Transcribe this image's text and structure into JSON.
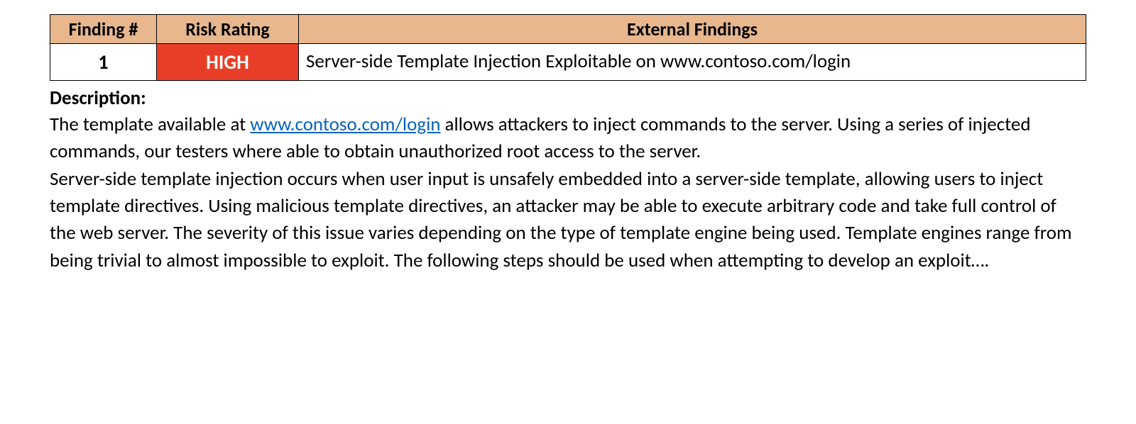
{
  "table": {
    "headers": {
      "finding": "Finding #",
      "risk": "Risk Rating",
      "external": "External Findings"
    },
    "row": {
      "finding_num": "1",
      "risk_rating": "HIGH",
      "summary": "Server-side Template Injection Exploitable on www.contoso.com/login"
    }
  },
  "description": {
    "label": "Description:",
    "para1_pre": "The template available at ",
    "para1_link_text": "www.contoso.com/login",
    "para1_link_href": "http://www.contoso.com/login",
    "para1_post": " allows attackers to inject commands to the server. Using a series of injected commands, our testers where able to obtain unauthorized root access to the server.",
    "para2": "Server-side template injection occurs when user input is unsafely embedded into a server-side template, allowing users to inject template directives. Using malicious template directives, an attacker may be able to execute arbitrary code and take full control of the web server. The severity of this issue varies depending on the type of template engine being used. Template engines range from being trivial to almost impossible to exploit. The following steps should be used when attempting to develop an exploit…."
  },
  "colors": {
    "header_bg": "#e8b78e",
    "risk_high_bg": "#e83e27",
    "link": "#0563c1"
  }
}
